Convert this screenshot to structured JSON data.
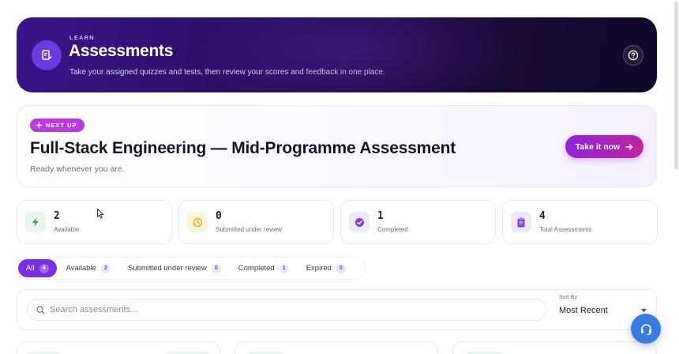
{
  "hero": {
    "eyebrow": "LEARN",
    "title": "Assessments",
    "subtitle": "Take your assigned quizzes and tests, then review your scores and feedback in one place.",
    "icon": "edit-document-icon",
    "help_icon": "help-circle-icon"
  },
  "next_up": {
    "badge": "NEXT UP",
    "title": "Full-Stack Engineering — Mid-Programme Assessment",
    "subtitle": "Ready whenever you are.",
    "button_label": "Take it now"
  },
  "stats": [
    {
      "value": "2",
      "label": "Available",
      "icon": "bolt-icon",
      "color": "#3f9a52",
      "bg": "#e8f6ec"
    },
    {
      "value": "0",
      "label": "Submitted under review",
      "icon": "clock-icon",
      "color": "#d9a514",
      "bg": "#fdf3d6"
    },
    {
      "value": "1",
      "label": "Completed",
      "icon": "check-circle-icon",
      "color": "#7b3fd6",
      "bg": "#efe6fb"
    },
    {
      "value": "4",
      "label": "Total Assessments",
      "icon": "clipboard-icon",
      "color": "#7b3fd6",
      "bg": "#efe6fb"
    }
  ],
  "tabs": [
    {
      "label": "All",
      "count": "4",
      "active": true
    },
    {
      "label": "Available",
      "count": "2",
      "active": false
    },
    {
      "label": "Submitted under review",
      "count": "0",
      "active": false
    },
    {
      "label": "Completed",
      "count": "1",
      "active": false
    },
    {
      "label": "Expired",
      "count": "0",
      "active": false
    }
  ],
  "search": {
    "placeholder": "Search assessments..."
  },
  "sort": {
    "label": "Sort By:",
    "value": "Most Recent"
  },
  "colors": {
    "accent": "#7b2fe0",
    "hero_bg": "#2a0f64",
    "cta_start": "#8e24d8",
    "cta_end": "#c0269e",
    "support": "#3b7be0"
  }
}
